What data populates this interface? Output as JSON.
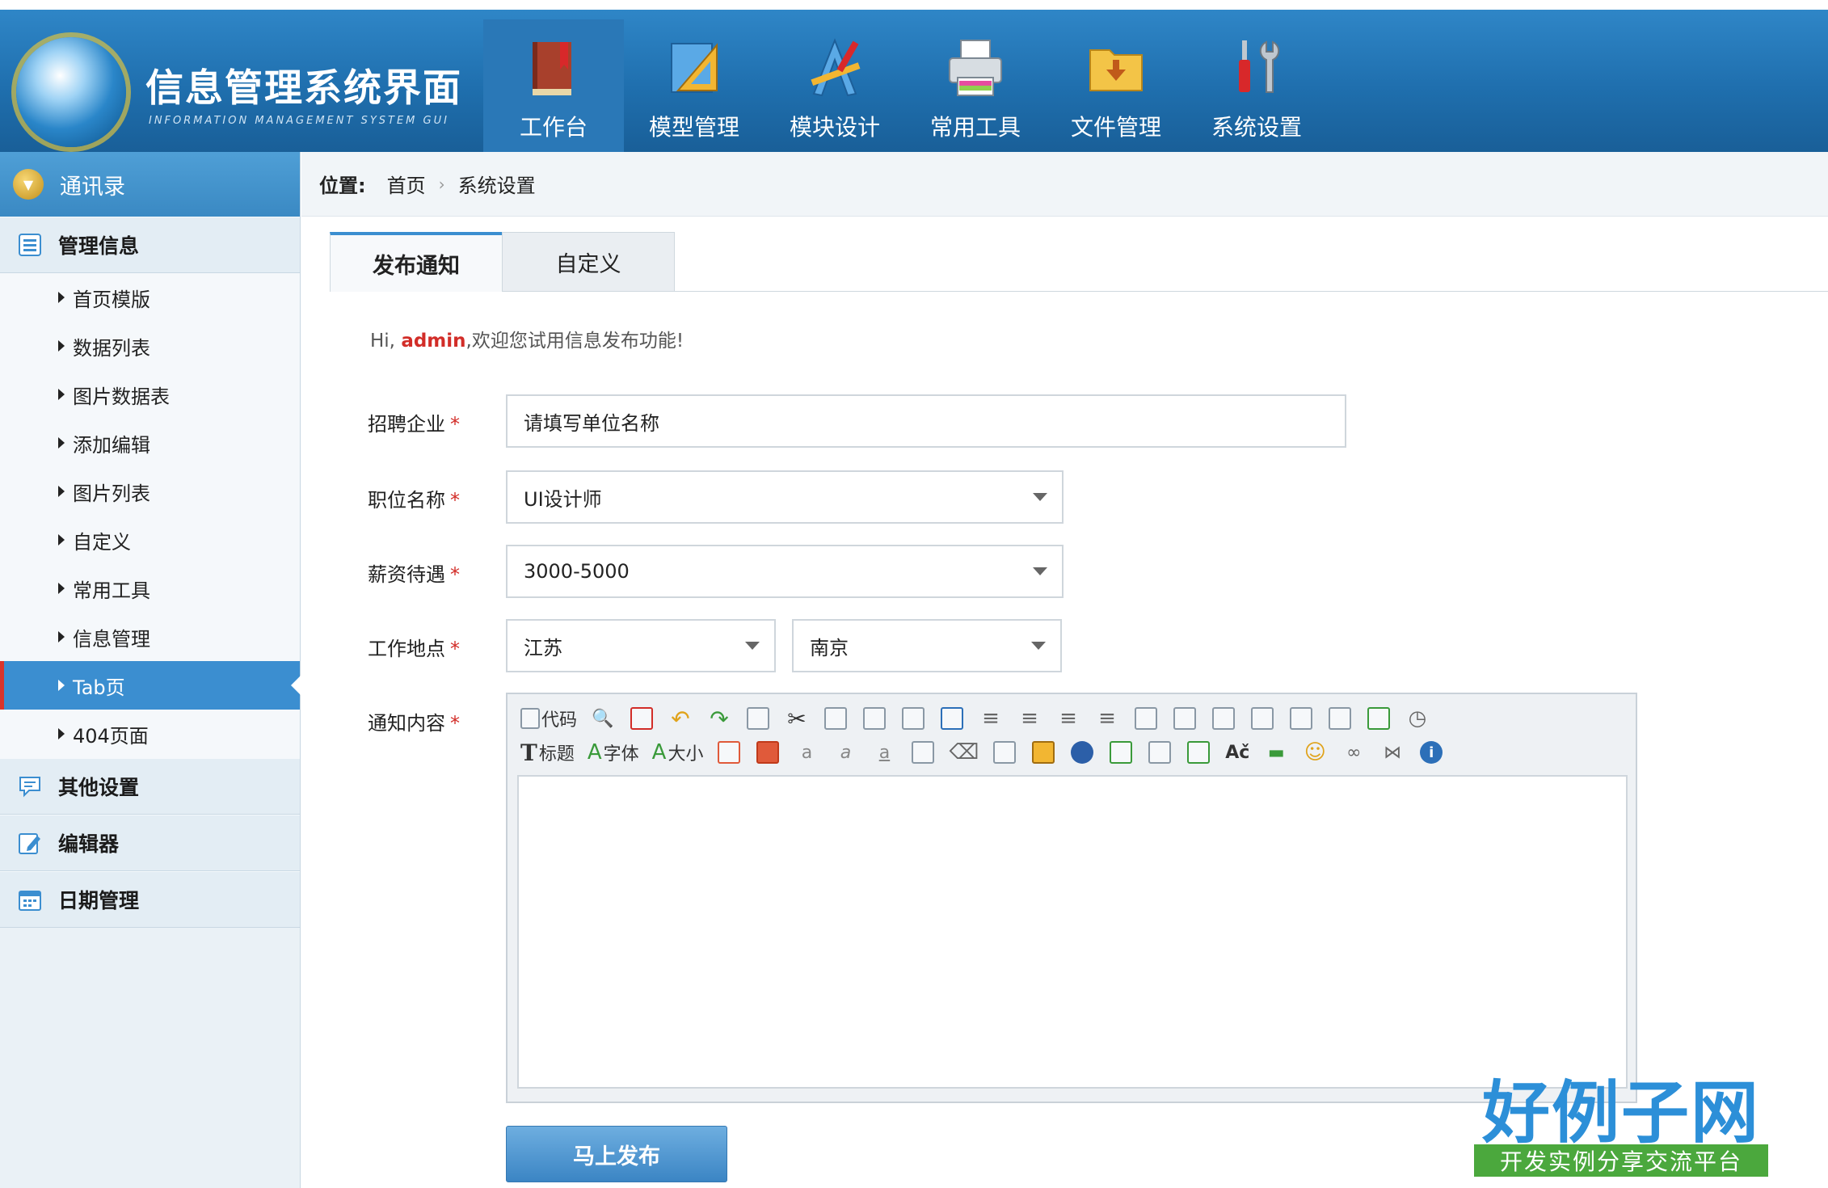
{
  "header": {
    "title": "信息管理系统界面",
    "subtitle": "INFORMATION MANAGEMENT SYSTEM GUI",
    "nav": [
      {
        "label": "工作台",
        "icon": "book-icon",
        "active": true
      },
      {
        "label": "模型管理",
        "icon": "ruler-triangle-icon"
      },
      {
        "label": "模块设计",
        "icon": "design-tools-icon"
      },
      {
        "label": "常用工具",
        "icon": "printer-icon"
      },
      {
        "label": "文件管理",
        "icon": "folder-icon"
      },
      {
        "label": "系统设置",
        "icon": "wrench-screwdriver-icon"
      }
    ]
  },
  "sidebar": {
    "top": {
      "label": "通讯录",
      "icon": "chevron-down-icon"
    },
    "sections": [
      {
        "label": "管理信息",
        "icon": "list-icon"
      },
      {
        "label": "其他设置",
        "icon": "comment-icon"
      },
      {
        "label": "编辑器",
        "icon": "edit-icon"
      },
      {
        "label": "日期管理",
        "icon": "calendar-icon"
      }
    ],
    "items": [
      "首页模版",
      "数据列表",
      "图片数据表",
      "添加编辑",
      "图片列表",
      "自定义",
      "常用工具",
      "信息管理",
      "Tab页",
      "404页面"
    ],
    "active_item": "Tab页"
  },
  "breadcrumb": {
    "label": "位置:",
    "home": "首页",
    "separator": "›",
    "current": "系统设置"
  },
  "tabs": [
    {
      "label": "发布通知",
      "active": true
    },
    {
      "label": "自定义"
    }
  ],
  "greeting": {
    "prefix": "Hi,",
    "user": "admin",
    "suffix": ",欢迎您试用信息发布功能!"
  },
  "form": {
    "company": {
      "label": "招聘企业",
      "required": "*",
      "placeholder": "请填写单位名称"
    },
    "position": {
      "label": "职位名称",
      "required": "*",
      "value": "UI设计师"
    },
    "salary": {
      "label": "薪资待遇",
      "required": "*",
      "value": "3000-5000"
    },
    "location": {
      "label": "工作地点",
      "required": "*",
      "province": "江苏",
      "city": "南京"
    },
    "content": {
      "label": "通知内容",
      "required": "*"
    },
    "submit": "马上发布"
  },
  "editor": {
    "row1": {
      "code_label": "代码"
    },
    "row2": {
      "heading_label": "标题",
      "font_label": "字体",
      "size_label": "大小"
    }
  },
  "watermark": {
    "big": "好例子网",
    "small": "开发实例分享交流平台"
  },
  "colors": {
    "primary": "#2f86c7",
    "active_tab_border": "#8fc63d",
    "required": "#d22d28",
    "active_item": "#3b8ed0"
  }
}
